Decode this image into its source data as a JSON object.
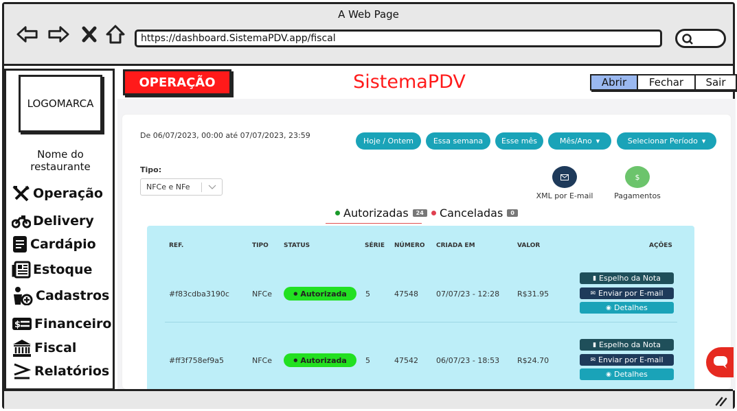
{
  "window": {
    "title": "A Web Page",
    "url": "https://dashboard.SistemaPDV.app/fiscal"
  },
  "sidebar": {
    "logo": "LOGOMARCA",
    "restaurant_name": "Nome do restaurante",
    "items": [
      {
        "label": "Operação",
        "icon": "utensils-icon"
      },
      {
        "label": "Delivery",
        "icon": "motorcycle-icon"
      },
      {
        "label": "Cardápio",
        "icon": "menu-card-icon"
      },
      {
        "label": "Estoque",
        "icon": "newspaper-icon"
      },
      {
        "label": "Cadastros",
        "icon": "user-plus-icon"
      },
      {
        "label": "Financeiro",
        "icon": "money-icon"
      },
      {
        "label": "Fiscal",
        "icon": "bank-icon"
      },
      {
        "label": "Relatórios",
        "icon": "greater-equal-icon"
      }
    ]
  },
  "header": {
    "section_badge": "OPERAÇÃO",
    "brand": "SistemaPDV",
    "buttons": [
      "Abrir",
      "Fechar",
      "Sair"
    ]
  },
  "filters": {
    "date_range": "De 06/07/2023, 00:00 até 07/07/2023, 23:59",
    "periods": [
      "Hoje / Ontem",
      "Essa semana",
      "Esse mês",
      "Mês/Ano",
      "Selecionar Período"
    ],
    "tipo_label": "Tipo:",
    "tipo_value": "NFCe e NFe"
  },
  "quick_actions": [
    {
      "label": "XML por E-mail",
      "icon": "envelope-icon",
      "color": "#1e3a5a"
    },
    {
      "label": "Pagamentos",
      "icon": "dollar-icon",
      "color": "#6cc46c"
    }
  ],
  "tabs": [
    {
      "label": "Autorizadas",
      "count": "24",
      "color": "#1a9a2a"
    },
    {
      "label": "Canceladas",
      "count": "0",
      "color": "#e04050"
    }
  ],
  "table": {
    "headers": [
      "REF.",
      "TIPO",
      "STATUS",
      "SÉRIE",
      "NÚMERO",
      "CRIADA EM",
      "VALOR",
      "AÇÕES"
    ],
    "rows": [
      {
        "ref": "#f83cdba3190c",
        "tipo": "NFCe",
        "status": "Autorizada",
        "serie": "5",
        "numero": "47548",
        "criada": "07/07/23 - 12:28",
        "valor": "R$31.95"
      },
      {
        "ref": "#ff3f758ef9a5",
        "tipo": "NFCe",
        "status": "Autorizada",
        "serie": "5",
        "numero": "47542",
        "criada": "06/07/23 - 18:53",
        "valor": "R$24.70"
      }
    ],
    "row_actions": [
      "Espelho da Nota",
      "Enviar por E-mail",
      "Detalhes"
    ]
  }
}
